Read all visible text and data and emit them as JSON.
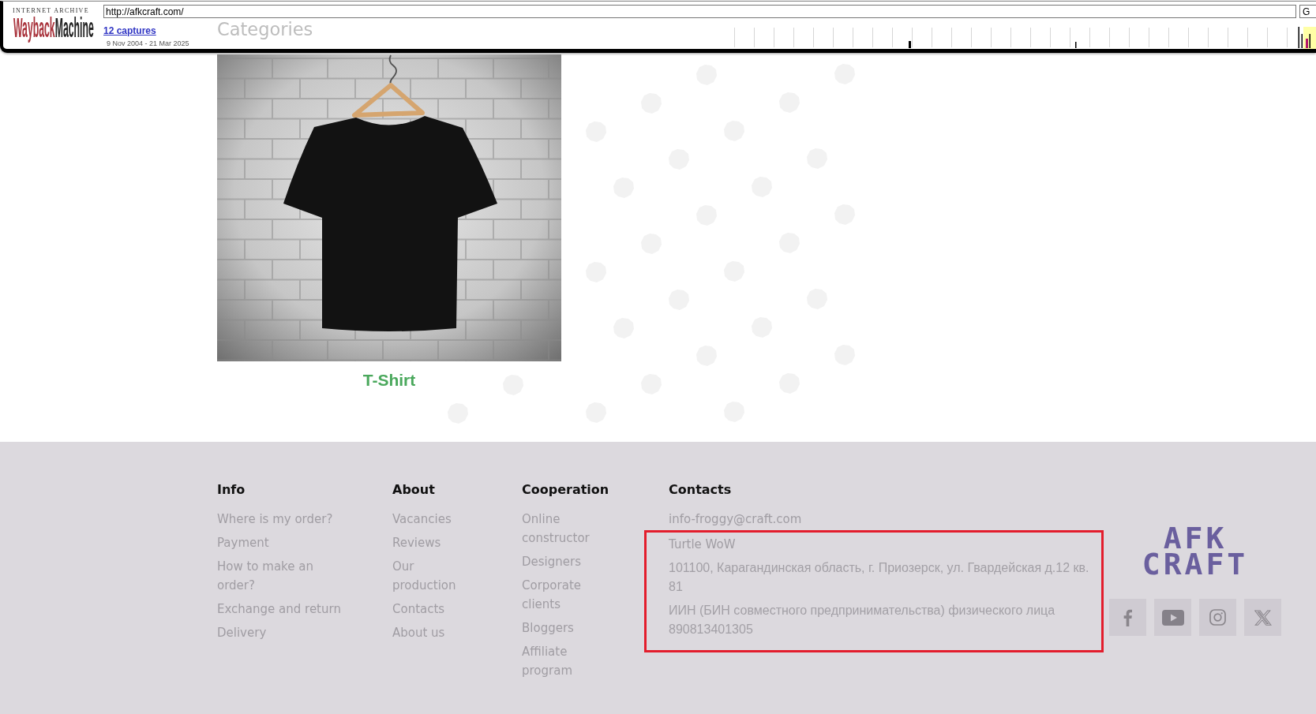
{
  "wayback_toolbar": {
    "logo": {
      "tagline": "INTERNET ARCHIVE",
      "name_part_1": "Wayback",
      "name_part_2": "Machine"
    },
    "url": "http://afkcraft.com/",
    "go_button": "G",
    "captures_link": "12 captures",
    "date_range": "9 Nov 2004 - 21 Mar 2025"
  },
  "page": {
    "heading": "Categories",
    "categories": [
      {
        "name": "T-Shirt"
      }
    ]
  },
  "footer": {
    "columns": [
      {
        "kind": "links",
        "title": "Info",
        "items": [
          "Where is my order?",
          "Payment",
          "How to make an order?",
          "Exchange and return",
          "Delivery"
        ]
      },
      {
        "kind": "links",
        "title": "About",
        "items": [
          "Vacancies",
          "Reviews",
          "Our production",
          "Contacts",
          "About us"
        ]
      },
      {
        "kind": "links",
        "title": "Cooperation",
        "items": [
          "Online constructor",
          "Designers",
          "Corporate clients",
          "Bloggers",
          "Affiliate program"
        ]
      },
      {
        "kind": "contacts",
        "title": "Contacts",
        "items": [
          {
            "kind": "email",
            "text": "info-froggy@craft.com",
            "highlighted": false
          },
          {
            "kind": "company",
            "text": "Turtle WoW",
            "highlighted": true
          },
          {
            "kind": "address",
            "text": "101100, Карагандинская область, г. Приозерск, ул. Гвардейская д.12 кв. 81",
            "highlighted": true
          },
          {
            "kind": "tax_id",
            "text": "ИИН (БИН совместного предпринимательства) физического лица 890813401305",
            "highlighted": true
          }
        ]
      }
    ],
    "logo": "AFK CRAFT"
  }
}
